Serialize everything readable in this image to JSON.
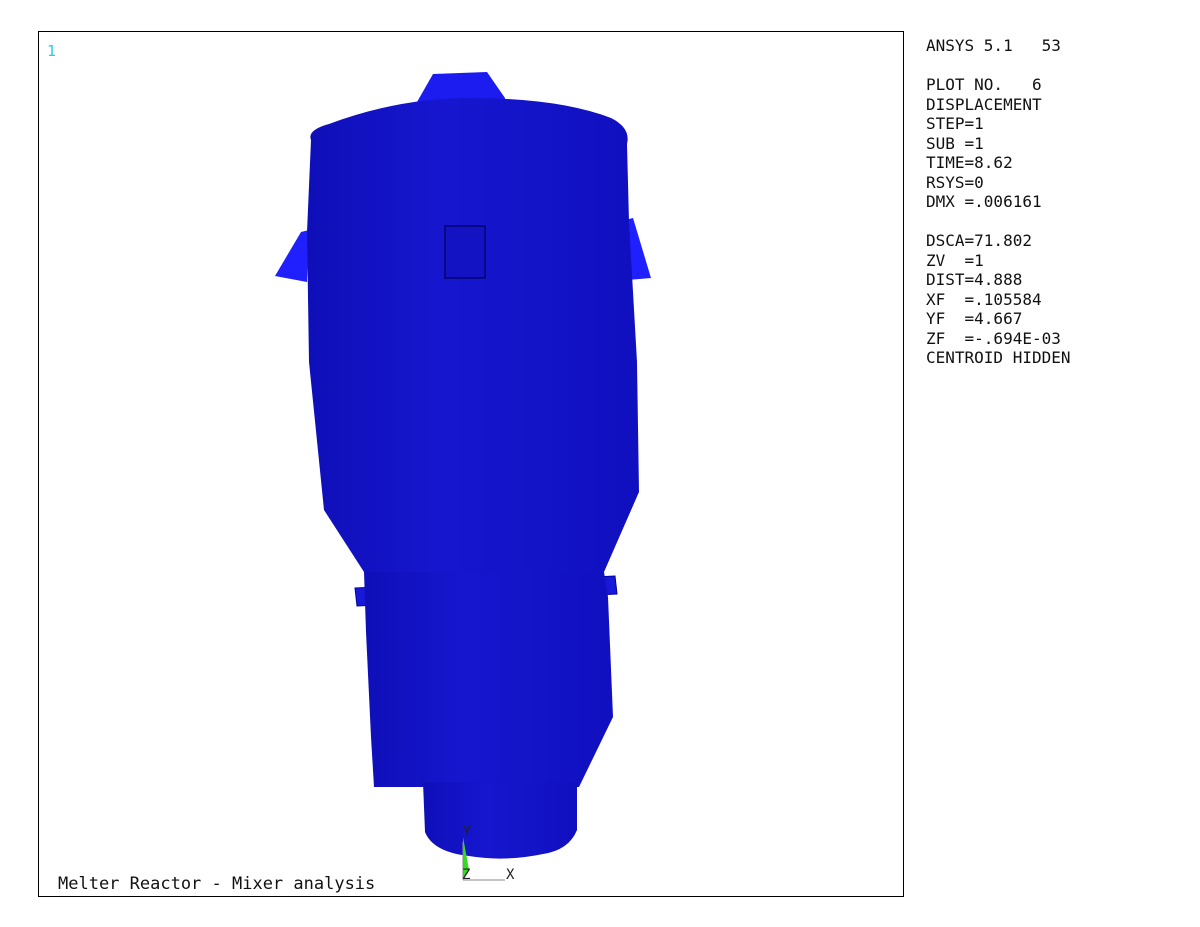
{
  "window_number": "1",
  "header": {
    "product": "ANSYS 5.1",
    "session_number": "53"
  },
  "info": {
    "plot_no": "PLOT NO.   6",
    "block1": [
      "DISPLACEMENT",
      "STEP=1",
      "SUB =1",
      "TIME=8.62",
      "RSYS=0",
      "DMX =.006161"
    ],
    "block2": [
      "DSCA=71.802",
      "ZV  =1",
      "DIST=4.888",
      "XF  =.105584",
      "YF  =4.667",
      "ZF  =-.694E-03",
      "CENTROID HIDDEN"
    ]
  },
  "plot_title": "Melter Reactor - Mixer analysis",
  "triad": {
    "y": "Y",
    "x": "X",
    "z": "Z"
  },
  "colors": {
    "model": "#1111cc",
    "model_edge": "#0000aa",
    "lugs": "#2222ff",
    "triad": "#33dd22",
    "window_number": "#22cfe6"
  }
}
